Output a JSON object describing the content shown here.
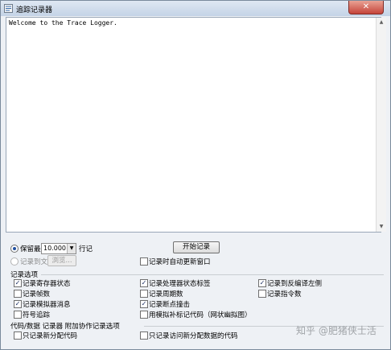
{
  "window": {
    "title": "追踪记录器",
    "close_label": "✕"
  },
  "log": {
    "text": "Welcome to the Trace Logger."
  },
  "options": {
    "keep_recent_label": "保留最后",
    "lines_value": "10.000",
    "lines_suffix": "行记",
    "log_to_file_label": "记录到文件",
    "browse_label": "浏览...",
    "start_label": "开始记录",
    "auto_update_label": "记录时自动更新窗口"
  },
  "record_options": {
    "title": "记录选项",
    "items": [
      {
        "label": "记录寄存器状态",
        "checked": true
      },
      {
        "label": "记录处理器状态标签",
        "checked": true
      },
      {
        "label": "记录到反编译左侧",
        "checked": true
      },
      {
        "label": "记录帧数",
        "checked": false
      },
      {
        "label": "记录周期数",
        "checked": false
      },
      {
        "label": "记录指令数",
        "checked": false
      },
      {
        "label": "记录模拟器消息",
        "checked": true
      },
      {
        "label": "记录断点撞击",
        "checked": true
      },
      {
        "label": "符号追踪",
        "checked": false
      },
      {
        "label": "用模拟补标记代码（网状幽拟图）",
        "checked": false
      }
    ]
  },
  "code_options": {
    "title": "代码/数据 记录器 附加协作记录选项",
    "items": [
      {
        "label": "只记录新分配代码",
        "checked": false
      },
      {
        "label": "只记录访问新分配数据的代码",
        "checked": false
      }
    ]
  },
  "watermark": "知乎 @肥猪侠士活",
  "colors": {
    "titlebar": "#c4d3e6",
    "close": "#c5443a",
    "check": "#1d2f63"
  }
}
